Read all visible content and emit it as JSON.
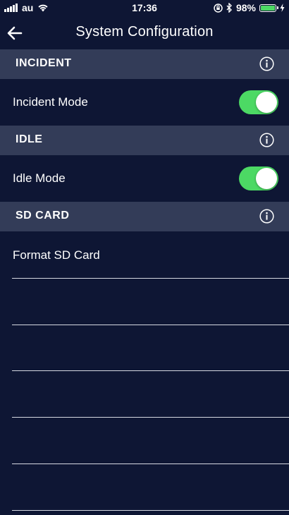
{
  "status_bar": {
    "carrier": "au",
    "time": "17:36",
    "battery_percent": "98%"
  },
  "nav": {
    "title": "System Configuration"
  },
  "sections": {
    "incident": {
      "label": "INCIDENT",
      "row_label": "Incident Mode",
      "toggle_on": true
    },
    "idle": {
      "label": "IDLE",
      "row_label": "Idle Mode",
      "toggle_on": true
    },
    "sd_card": {
      "label": "SD CARD",
      "row_label": "Format SD Card"
    }
  },
  "colors": {
    "background": "#0e1634",
    "section_header": "#333c58",
    "toggle_on": "#4cd964"
  }
}
